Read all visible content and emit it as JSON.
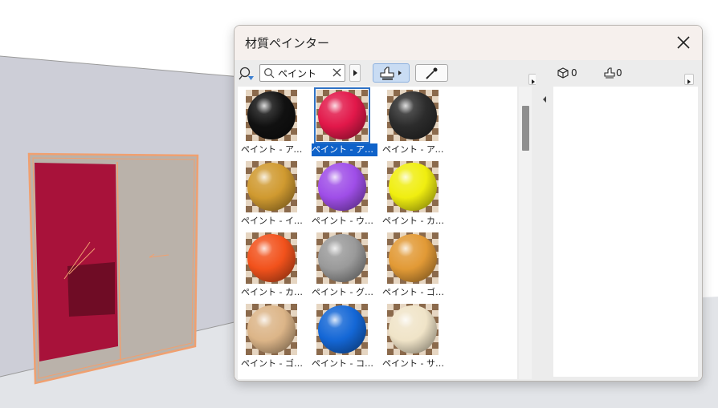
{
  "window": {
    "title": "材質ペインター",
    "close_icon": "close-icon"
  },
  "search": {
    "value": "ペイント",
    "icons": [
      "search-options-icon",
      "magnifier-icon",
      "clear-icon",
      "next-arrow-icon"
    ]
  },
  "toolbar": {
    "paint_mode_icon": "paint-brush-icon",
    "eyedropper_icon": "eyedropper-icon"
  },
  "materials": [
    {
      "label": "ペイント - アイ…",
      "color": "#111111",
      "selected": false
    },
    {
      "label": "ペイント - アリ…",
      "color": "#e2184a",
      "selected": true
    },
    {
      "label": "ペイント - アン…",
      "color": "#2c2c2c",
      "selected": false
    },
    {
      "label": "ペイント - イエ…",
      "color": "#d09a30",
      "selected": false
    },
    {
      "label": "ペイント - ウル…",
      "color": "#9f4ee8",
      "selected": false
    },
    {
      "label": "ペイント - カド…",
      "color": "#f0ee10",
      "selected": false
    },
    {
      "label": "ペイント - カド…",
      "color": "#f2521c",
      "selected": false
    },
    {
      "label": "ペイント - グロ…",
      "color": "#9a9a9a",
      "selected": false
    },
    {
      "label": "ペイント - ゴー…",
      "color": "#e29a36",
      "selected": false
    },
    {
      "label": "ペイント - ゴー…",
      "color": "#dcb588",
      "selected": false
    },
    {
      "label": "ペイント - コバ…",
      "color": "#1467d6",
      "selected": false
    },
    {
      "label": "ペイント - サン…",
      "color": "#f0e4c8",
      "selected": false
    }
  ],
  "selection": {
    "object_count": "0",
    "painted_count": "0",
    "object_icon": "cube-icon",
    "painted_icon": "paint-brush-icon"
  },
  "colors": {
    "accent": "#0f62c9",
    "door_panel": "#a8123a",
    "door_frame": "#f0a070"
  }
}
